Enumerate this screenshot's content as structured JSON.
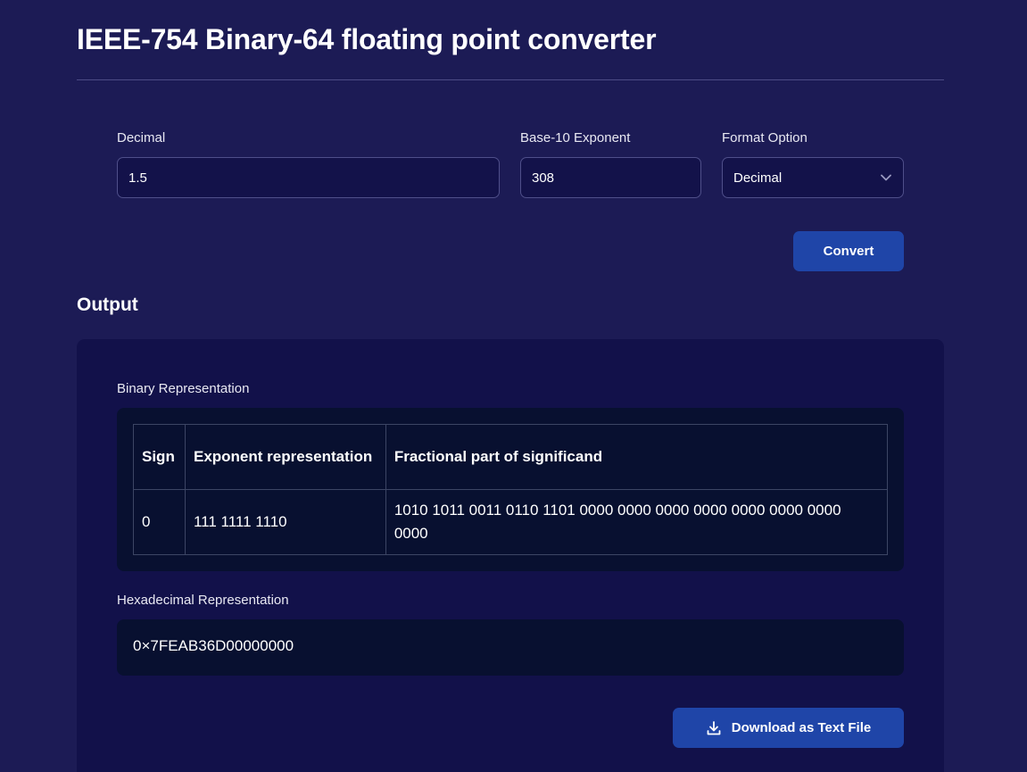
{
  "header": {
    "title": "IEEE-754 Binary-64 floating point converter"
  },
  "form": {
    "decimal": {
      "label": "Decimal",
      "value": "1.5"
    },
    "exponent": {
      "label": "Base-10 Exponent",
      "value": "308"
    },
    "format": {
      "label": "Format Option",
      "selected": "Decimal",
      "icon": "chevron-down-icon"
    },
    "convert_label": "Convert"
  },
  "output": {
    "title": "Output",
    "binary_label": "Binary Representation",
    "table": {
      "headers": [
        "Sign",
        "Exponent representation",
        "Fractional part of significand"
      ],
      "row": {
        "sign": "0",
        "exponent": "111 1111 1110",
        "fraction": "1010 1011 0011 0110 1101 0000 0000 0000 0000 0000 0000 0000 0000"
      }
    },
    "hex_label": "Hexadecimal Representation",
    "hex_value": "0×7FEAB36D00000000",
    "download_label": "Download as Text File",
    "download_icon": "download-icon"
  },
  "colors": {
    "background": "#1c1b55",
    "panel": "#12114a",
    "code_box": "#081030",
    "button": "#1f45a8"
  }
}
